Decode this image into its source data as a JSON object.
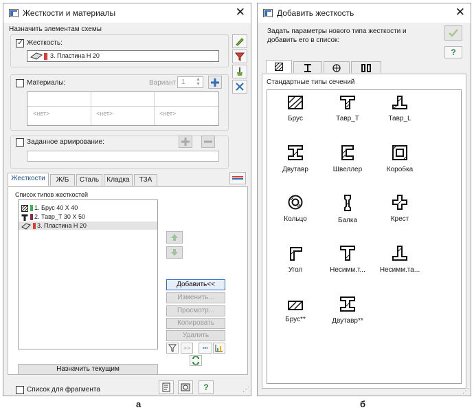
{
  "left_window": {
    "title": "Жесткости и материалы",
    "assign_label": "Назначить элементам схемы",
    "stiffness_label": "Жесткость:",
    "stiffness_checked": true,
    "stiffness_value": "3. Пластина  Н 20",
    "materials_label": "Материалы:",
    "variant_label": "Вариант",
    "variant_value": "1",
    "materials_cells": [
      "<нет>",
      "<нет>",
      "<нет>"
    ],
    "reinforcement_label": "Заданное армирование:",
    "tabs": [
      "Жесткости",
      "Ж/Б",
      "Сталь",
      "Кладка",
      "ТЗА"
    ],
    "list_title": "Список типов жесткостей",
    "list_items": [
      {
        "label": "1. Брус 40 X 40",
        "color": "#39b54a",
        "selected": false
      },
      {
        "label": "2. Тавр_Т 30 X 50",
        "color": "#8b2a4a",
        "selected": false
      },
      {
        "label": "3. Пластина  Н 20",
        "color": "#e03c31",
        "selected": true
      }
    ],
    "buttons": {
      "add": "Добавить<<",
      "edit": "Изменить...",
      "view": "Просмотр...",
      "copy": "Копировать",
      "delete": "Удалить"
    },
    "assign_current": "Назначить текущим",
    "fragment_label": "Список для фрагмента",
    "help_glyph": "?"
  },
  "right_window": {
    "title": "Добавить жесткость",
    "instructions": "Задать параметры нового типа жесткости и добавить его в список:",
    "help_glyph": "?",
    "tab_icons": [
      "hatched-square-icon",
      "i-beam-icon",
      "circle-cross-icon",
      "double-beam-icon"
    ],
    "section_header": "Стандартные типы сечений",
    "sections": [
      {
        "label": "Брус",
        "icon": "rect-section-icon"
      },
      {
        "label": "Тавр_Т",
        "icon": "t-section-icon"
      },
      {
        "label": "Тавр_L",
        "icon": "inverted-t-section-icon"
      },
      {
        "label": "Двутавр",
        "icon": "i-beam-section-icon"
      },
      {
        "label": "Швеллер",
        "icon": "channel-section-icon"
      },
      {
        "label": "Коробка",
        "icon": "box-section-icon"
      },
      {
        "label": "Кольцо",
        "icon": "ring-section-icon"
      },
      {
        "label": "Балка",
        "icon": "beam-section-icon"
      },
      {
        "label": "Крест",
        "icon": "cross-section-icon"
      },
      {
        "label": "Угол",
        "icon": "angle-section-icon"
      },
      {
        "label": "Несимм.т...",
        "icon": "asym-t-section-icon"
      },
      {
        "label": "Несимм.та...",
        "icon": "asym-t-inverted-section-icon"
      },
      {
        "label": "Брус**",
        "icon": "rect-section-icon"
      },
      {
        "label": "Двутавр**",
        "icon": "i-beam-section-icon"
      }
    ]
  },
  "captions": {
    "left": "а",
    "right": "б"
  }
}
